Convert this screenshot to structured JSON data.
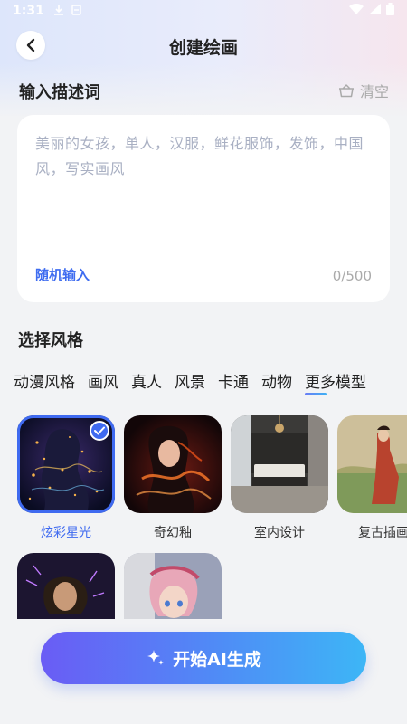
{
  "status_bar": {
    "time": "1:31"
  },
  "nav": {
    "title": "创建绘画"
  },
  "prompt": {
    "section_title": "输入描述词",
    "clear_label": "清空",
    "placeholder": "美丽的女孩，单人，汉服，鲜花服饰，发饰，中国风，写实画风",
    "random_label": "随机输入",
    "counter": "0/500"
  },
  "style": {
    "section_title": "选择风格",
    "tabs": [
      "动漫风格",
      "画风",
      "真人",
      "风景",
      "卡通",
      "动物",
      "更多模型"
    ],
    "items": [
      {
        "label": "炫彩星光",
        "selected": true
      },
      {
        "label": "奇幻釉",
        "selected": false
      },
      {
        "label": "室内设计",
        "selected": false
      },
      {
        "label": "复古插画",
        "selected": false
      },
      {
        "label": "",
        "selected": false
      },
      {
        "label": "",
        "selected": false
      }
    ]
  },
  "generate": {
    "label": "开始AI生成"
  },
  "colors": {
    "accent": "#3f6af0",
    "button_start": "#6a5cf5",
    "button_end": "#3db6f6"
  }
}
